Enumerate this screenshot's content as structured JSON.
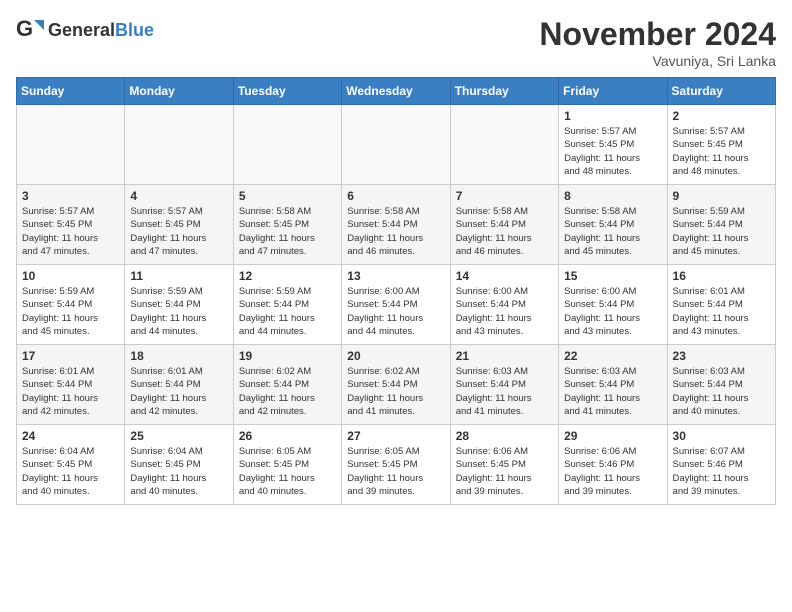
{
  "header": {
    "logo_general": "General",
    "logo_blue": "Blue",
    "month": "November 2024",
    "location": "Vavuniya, Sri Lanka"
  },
  "weekdays": [
    "Sunday",
    "Monday",
    "Tuesday",
    "Wednesday",
    "Thursday",
    "Friday",
    "Saturday"
  ],
  "weeks": [
    [
      {
        "day": "",
        "info": ""
      },
      {
        "day": "",
        "info": ""
      },
      {
        "day": "",
        "info": ""
      },
      {
        "day": "",
        "info": ""
      },
      {
        "day": "",
        "info": ""
      },
      {
        "day": "1",
        "info": "Sunrise: 5:57 AM\nSunset: 5:45 PM\nDaylight: 11 hours\nand 48 minutes."
      },
      {
        "day": "2",
        "info": "Sunrise: 5:57 AM\nSunset: 5:45 PM\nDaylight: 11 hours\nand 48 minutes."
      }
    ],
    [
      {
        "day": "3",
        "info": "Sunrise: 5:57 AM\nSunset: 5:45 PM\nDaylight: 11 hours\nand 47 minutes."
      },
      {
        "day": "4",
        "info": "Sunrise: 5:57 AM\nSunset: 5:45 PM\nDaylight: 11 hours\nand 47 minutes."
      },
      {
        "day": "5",
        "info": "Sunrise: 5:58 AM\nSunset: 5:45 PM\nDaylight: 11 hours\nand 47 minutes."
      },
      {
        "day": "6",
        "info": "Sunrise: 5:58 AM\nSunset: 5:44 PM\nDaylight: 11 hours\nand 46 minutes."
      },
      {
        "day": "7",
        "info": "Sunrise: 5:58 AM\nSunset: 5:44 PM\nDaylight: 11 hours\nand 46 minutes."
      },
      {
        "day": "8",
        "info": "Sunrise: 5:58 AM\nSunset: 5:44 PM\nDaylight: 11 hours\nand 45 minutes."
      },
      {
        "day": "9",
        "info": "Sunrise: 5:59 AM\nSunset: 5:44 PM\nDaylight: 11 hours\nand 45 minutes."
      }
    ],
    [
      {
        "day": "10",
        "info": "Sunrise: 5:59 AM\nSunset: 5:44 PM\nDaylight: 11 hours\nand 45 minutes."
      },
      {
        "day": "11",
        "info": "Sunrise: 5:59 AM\nSunset: 5:44 PM\nDaylight: 11 hours\nand 44 minutes."
      },
      {
        "day": "12",
        "info": "Sunrise: 5:59 AM\nSunset: 5:44 PM\nDaylight: 11 hours\nand 44 minutes."
      },
      {
        "day": "13",
        "info": "Sunrise: 6:00 AM\nSunset: 5:44 PM\nDaylight: 11 hours\nand 44 minutes."
      },
      {
        "day": "14",
        "info": "Sunrise: 6:00 AM\nSunset: 5:44 PM\nDaylight: 11 hours\nand 43 minutes."
      },
      {
        "day": "15",
        "info": "Sunrise: 6:00 AM\nSunset: 5:44 PM\nDaylight: 11 hours\nand 43 minutes."
      },
      {
        "day": "16",
        "info": "Sunrise: 6:01 AM\nSunset: 5:44 PM\nDaylight: 11 hours\nand 43 minutes."
      }
    ],
    [
      {
        "day": "17",
        "info": "Sunrise: 6:01 AM\nSunset: 5:44 PM\nDaylight: 11 hours\nand 42 minutes."
      },
      {
        "day": "18",
        "info": "Sunrise: 6:01 AM\nSunset: 5:44 PM\nDaylight: 11 hours\nand 42 minutes."
      },
      {
        "day": "19",
        "info": "Sunrise: 6:02 AM\nSunset: 5:44 PM\nDaylight: 11 hours\nand 42 minutes."
      },
      {
        "day": "20",
        "info": "Sunrise: 6:02 AM\nSunset: 5:44 PM\nDaylight: 11 hours\nand 41 minutes."
      },
      {
        "day": "21",
        "info": "Sunrise: 6:03 AM\nSunset: 5:44 PM\nDaylight: 11 hours\nand 41 minutes."
      },
      {
        "day": "22",
        "info": "Sunrise: 6:03 AM\nSunset: 5:44 PM\nDaylight: 11 hours\nand 41 minutes."
      },
      {
        "day": "23",
        "info": "Sunrise: 6:03 AM\nSunset: 5:44 PM\nDaylight: 11 hours\nand 40 minutes."
      }
    ],
    [
      {
        "day": "24",
        "info": "Sunrise: 6:04 AM\nSunset: 5:45 PM\nDaylight: 11 hours\nand 40 minutes."
      },
      {
        "day": "25",
        "info": "Sunrise: 6:04 AM\nSunset: 5:45 PM\nDaylight: 11 hours\nand 40 minutes."
      },
      {
        "day": "26",
        "info": "Sunrise: 6:05 AM\nSunset: 5:45 PM\nDaylight: 11 hours\nand 40 minutes."
      },
      {
        "day": "27",
        "info": "Sunrise: 6:05 AM\nSunset: 5:45 PM\nDaylight: 11 hours\nand 39 minutes."
      },
      {
        "day": "28",
        "info": "Sunrise: 6:06 AM\nSunset: 5:45 PM\nDaylight: 11 hours\nand 39 minutes."
      },
      {
        "day": "29",
        "info": "Sunrise: 6:06 AM\nSunset: 5:46 PM\nDaylight: 11 hours\nand 39 minutes."
      },
      {
        "day": "30",
        "info": "Sunrise: 6:07 AM\nSunset: 5:46 PM\nDaylight: 11 hours\nand 39 minutes."
      }
    ]
  ]
}
